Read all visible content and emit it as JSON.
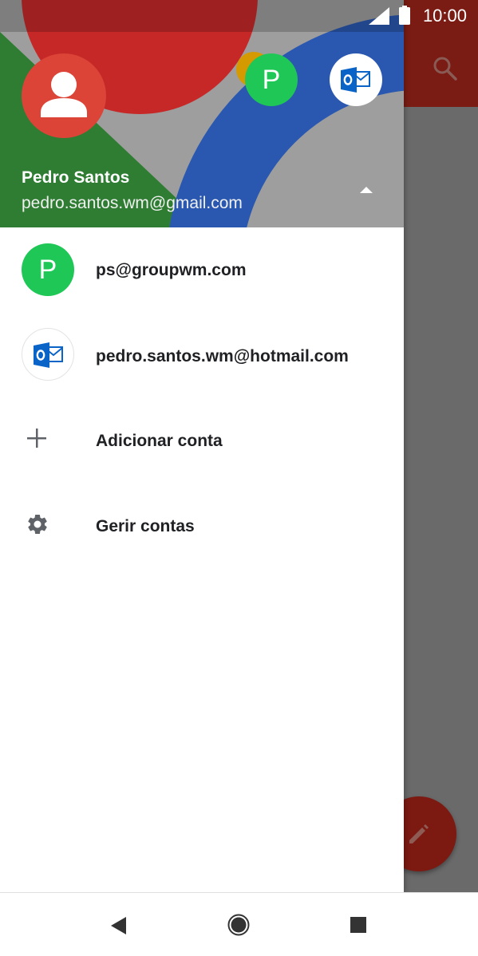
{
  "status_bar": {
    "time": "10:00"
  },
  "header": {
    "name": "Pedro Santos",
    "email": "pedro.santos.wm@gmail.com",
    "secondary_avatar_letter": "P"
  },
  "accounts": [
    {
      "avatar_letter": "P",
      "email": "ps@groupwm.com",
      "icon": "letter-avatar"
    },
    {
      "email": "pedro.santos.wm@hotmail.com",
      "icon": "outlook-icon"
    }
  ],
  "actions": {
    "add_account": "Adicionar conta",
    "manage_accounts": "Gerir contas"
  },
  "colors": {
    "avatar_red": "#db4437",
    "avatar_green": "#1fc756",
    "outlook_blue": "#0a64c8",
    "appbar_dim": "#7a1c14"
  }
}
